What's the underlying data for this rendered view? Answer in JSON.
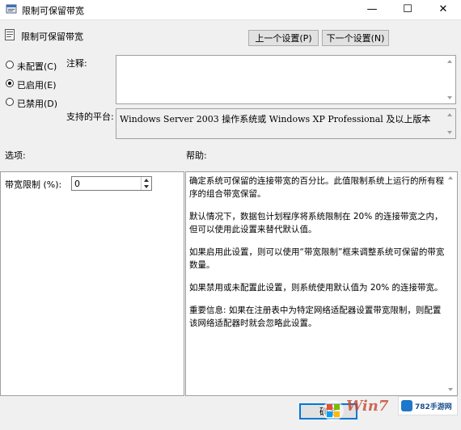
{
  "window": {
    "title": "限制可保留带宽",
    "minimize_glyph": "—",
    "maximize_glyph": "☐",
    "close_glyph": "✕"
  },
  "header": {
    "setting_name": "限制可保留带宽"
  },
  "nav": {
    "prev_label": "上一个设置(P)",
    "next_label": "下一个设置(N)"
  },
  "state": {
    "options": [
      {
        "label": "未配置(C)",
        "selected": false
      },
      {
        "label": "已启用(E)",
        "selected": true
      },
      {
        "label": "已禁用(D)",
        "selected": false
      }
    ]
  },
  "comment": {
    "label": "注释:",
    "value": ""
  },
  "platform": {
    "label": "支持的平台:",
    "value": "Windows Server 2003 操作系统或 Windows XP Professional 及以上版本"
  },
  "options_section": {
    "label": "选项:",
    "bandwidth_label": "带宽限制 (%):",
    "bandwidth_value": "0"
  },
  "help_section": {
    "label": "帮助:",
    "paragraphs": [
      "确定系统可保留的连接带宽的百分比。此值限制系统上运行的所有程序的组合带宽保留。",
      "默认情况下，数据包计划程序将系统限制在 20% 的连接带宽之内，但可以使用此设置来替代默认值。",
      "如果启用此设置，则可以使用“带宽限制”框来调整系统可保留的带宽数量。",
      "如果禁用或未配置此设置，则系统使用默认值为 20% 的连接带宽。",
      "重要信息: 如果在注册表中为特定网络适配器设置带宽限制，则配置该网络适配器时就会忽略此设置。"
    ]
  },
  "footer": {
    "ok_label": "确定"
  },
  "watermarks": {
    "site_logo": "782手游网",
    "win7_logo": "Win7"
  },
  "colors": {
    "accent": "#0078d7",
    "window_bg": "#f0f0f0"
  }
}
